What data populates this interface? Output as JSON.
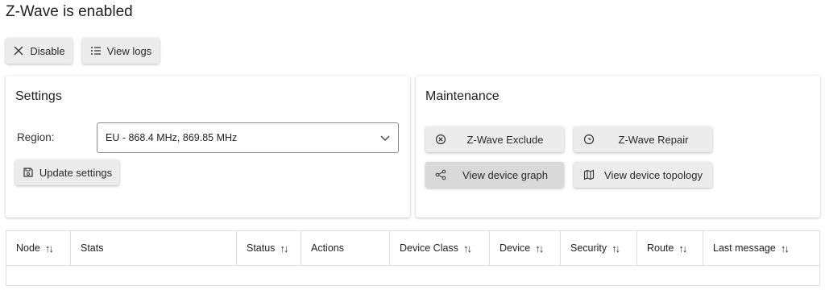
{
  "page_title": "Z-Wave is enabled",
  "toolbar": {
    "disable_label": "Disable",
    "view_logs_label": "View logs"
  },
  "settings": {
    "title": "Settings",
    "region_label": "Region:",
    "region_value": "EU - 868.4 MHz, 869.85 MHz",
    "update_label": "Update settings"
  },
  "maintenance": {
    "title": "Maintenance",
    "exclude_label": "Z-Wave Exclude",
    "repair_label": "Z-Wave Repair",
    "graph_label": "View device graph",
    "topology_label": "View device topology"
  },
  "table": {
    "columns": [
      {
        "label": "Node",
        "sortable": true
      },
      {
        "label": "Stats",
        "sortable": false
      },
      {
        "label": "Status",
        "sortable": true
      },
      {
        "label": "Actions",
        "sortable": false
      },
      {
        "label": "Device Class",
        "sortable": true
      },
      {
        "label": "Device",
        "sortable": true
      },
      {
        "label": "Security",
        "sortable": true
      },
      {
        "label": "Route",
        "sortable": true
      },
      {
        "label": "Last message",
        "sortable": true
      }
    ],
    "sort_glyph": "↑↓",
    "rows": []
  },
  "icons": {
    "disable": "close-icon",
    "view_logs": "list-icon",
    "update": "save-icon",
    "exclude": "circle-x-icon",
    "repair": "repair-icon",
    "graph": "share-graph-icon",
    "topology": "map-icon",
    "region_dropdown": "chevron-down-icon"
  }
}
